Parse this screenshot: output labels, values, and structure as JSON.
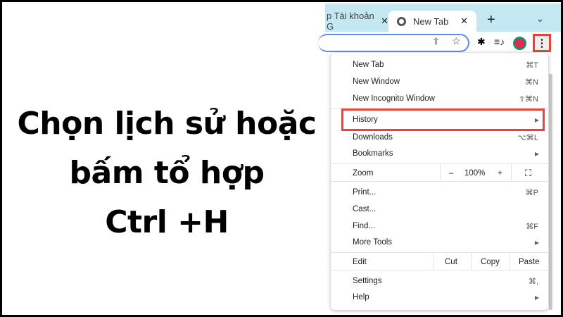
{
  "caption": {
    "lines": [
      "Chọn lịch sử hoặc",
      "bấm tổ hợp",
      "Ctrl +H"
    ]
  },
  "tabs": [
    {
      "label": "p Tài khoản G",
      "close": "✕"
    },
    {
      "label": "New Tab",
      "close": "✕",
      "active": true
    }
  ],
  "tabbar": {
    "new_tab": "+",
    "dropdown": "⌄"
  },
  "toolbar": {
    "share": "⇧",
    "star": "☆",
    "extensions": "✱",
    "media": "≡♪",
    "menu": "⋮"
  },
  "colors": {
    "tabbar": "#c4e8f1",
    "highlight": "#ea4335",
    "omnibox_border": "#5b8def"
  },
  "menu": {
    "items": [
      {
        "label": "New Tab",
        "shortcut": "⌘T"
      },
      {
        "label": "New Window",
        "shortcut": "⌘N"
      },
      {
        "label": "New Incognito Window",
        "shortcut": "⇧⌘N"
      },
      {
        "label": "History",
        "submenu": "▶",
        "highlighted": true
      },
      {
        "label": "Downloads",
        "shortcut": "⌥⌘L"
      },
      {
        "label": "Bookmarks",
        "submenu": "▶"
      },
      {
        "label": "Print...",
        "shortcut": "⌘P"
      },
      {
        "label": "Cast..."
      },
      {
        "label": "Find...",
        "shortcut": "⌘F"
      },
      {
        "label": "More Tools",
        "submenu": "▶"
      },
      {
        "label": "Settings",
        "shortcut": "⌘,"
      },
      {
        "label": "Help",
        "submenu": "▶"
      }
    ],
    "zoom": {
      "label": "Zoom",
      "minus": "–",
      "value": "100%",
      "plus": "+",
      "fullscreen": "⛶"
    },
    "edit": {
      "label": "Edit",
      "cut": "Cut",
      "copy": "Copy",
      "paste": "Paste"
    }
  }
}
